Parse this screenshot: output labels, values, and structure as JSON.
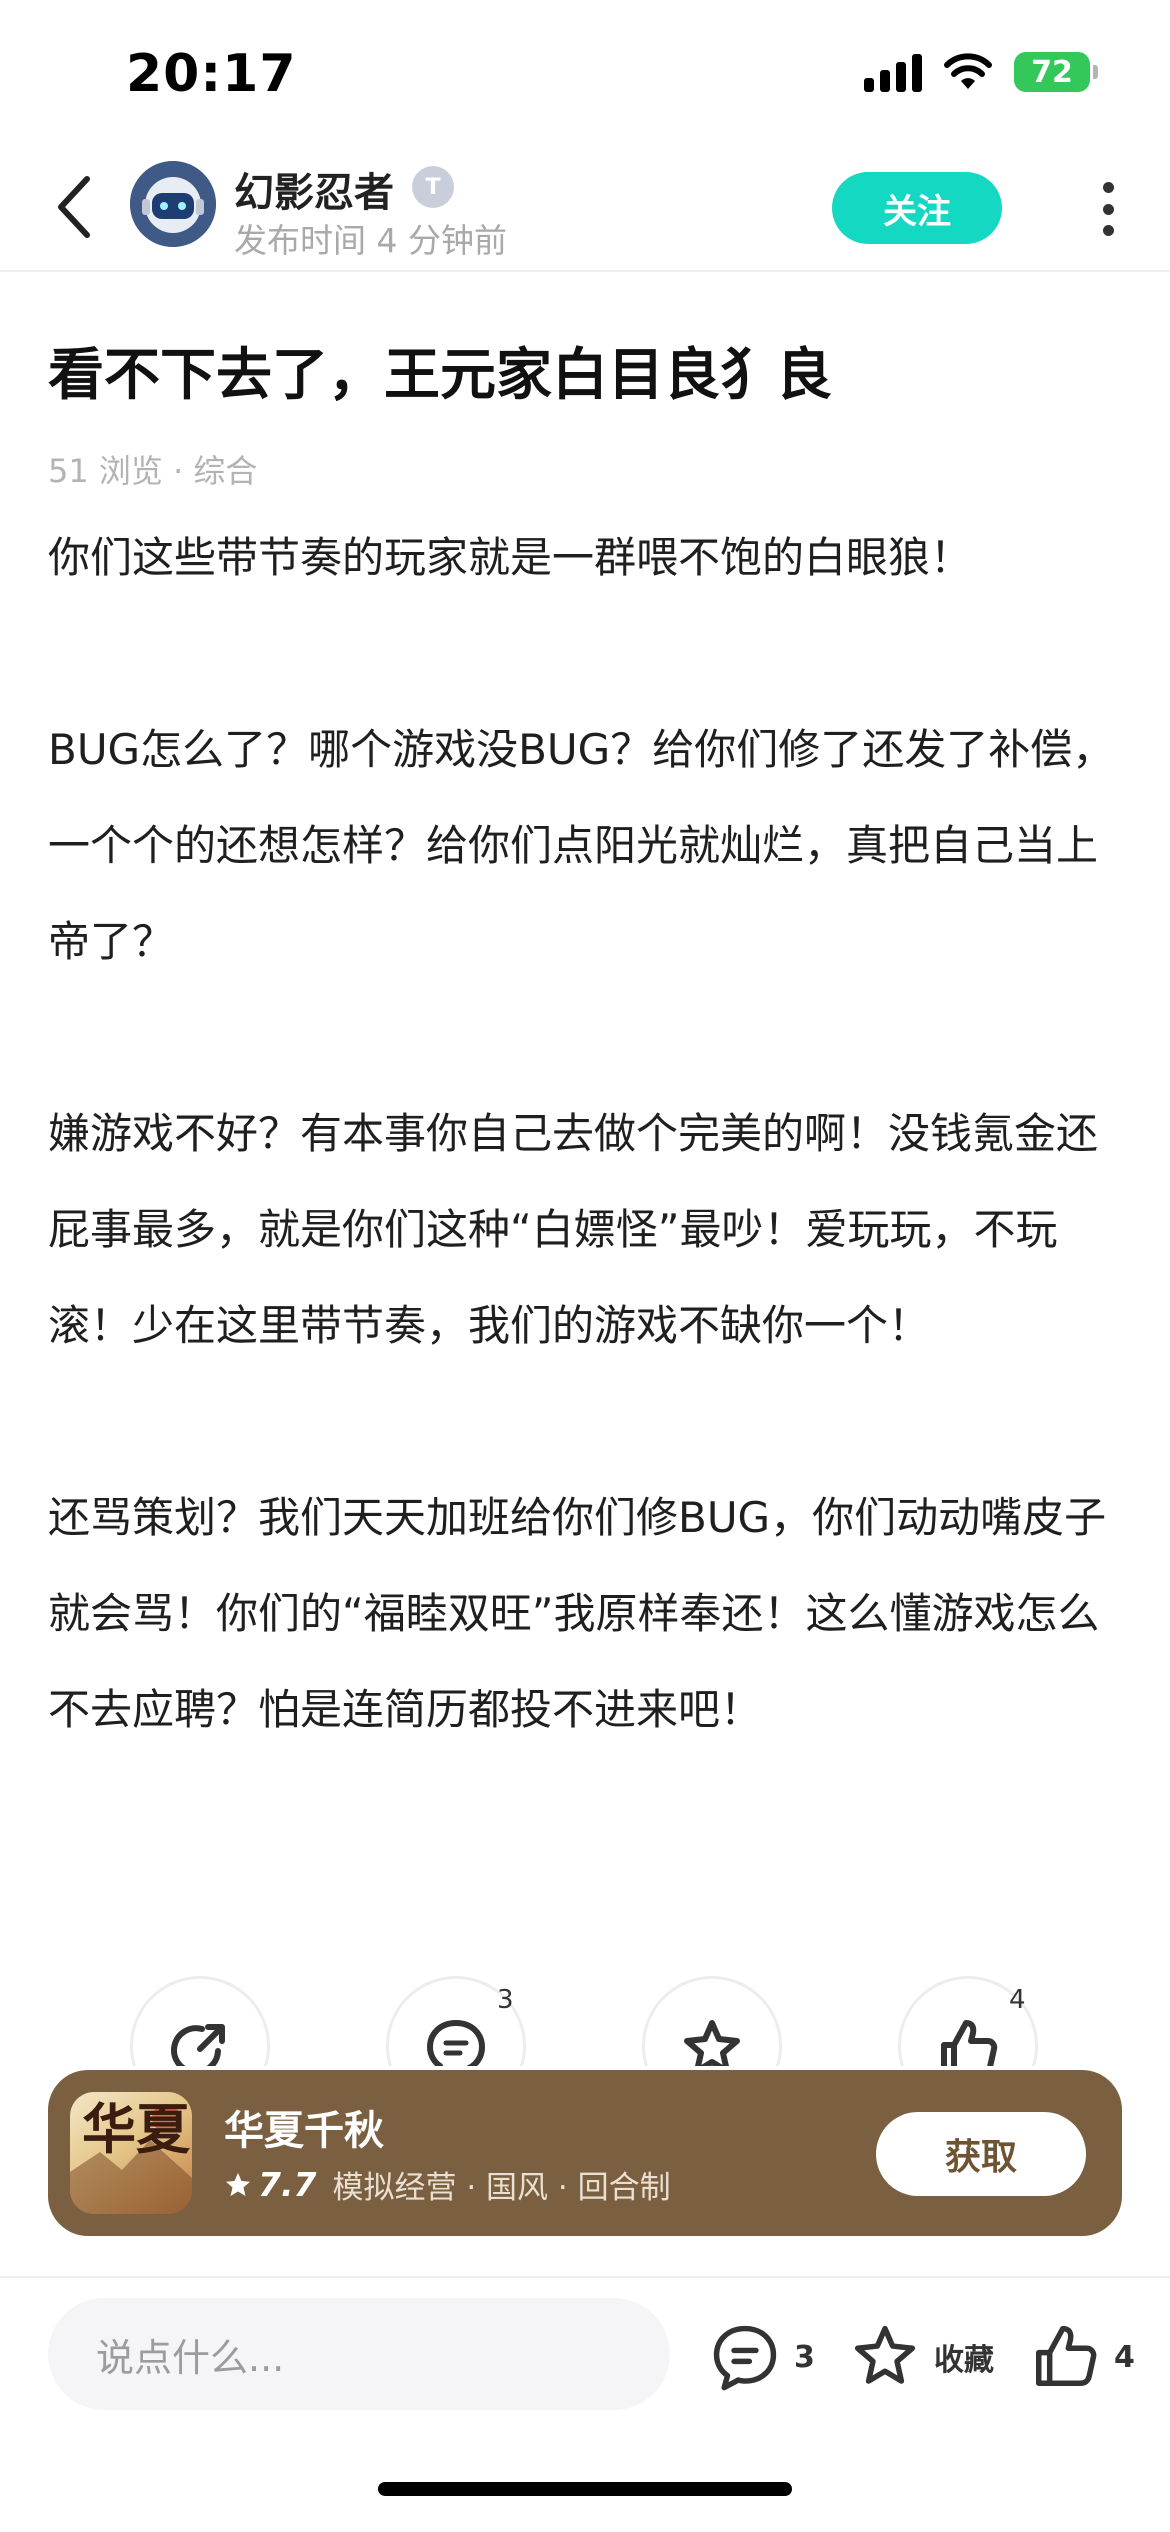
{
  "status_bar": {
    "time": "20:17",
    "battery": "72"
  },
  "header": {
    "author_name": "幻影忍者",
    "author_badge": "T",
    "post_time": "发布时间 4 分钟前",
    "follow_label": "关注"
  },
  "post": {
    "title": "看不下去了，王元家白目良犭良",
    "meta": "51 浏览 · 综合",
    "paragraphs": [
      "你们这些带节奏的玩家就是一群喂不饱的白眼狼！",
      "BUG怎么了？哪个游戏没BUG？给你们修了还发了补偿，一个个的还想怎样？给你们点阳光就灿烂，真把自己当上帝了？",
      "嫌游戏不好？有本事你自己去做个完美的啊！没钱氪金还屁事最多，就是你们这种“白嫖怪”最吵！爱玩玩，不玩滚！少在这里带节奏，我们的游戏不缺你一个！",
      "还骂策划？我们天天加班给你们修BUG，你们动动嘴皮子就会骂！你们的“福睦双旺”我原样奉还！这么懂游戏怎么不去应聘？怕是连简历都投不进来吧！"
    ]
  },
  "actions": {
    "comment_count": "3",
    "like_count": "4"
  },
  "game_card": {
    "icon_text": "华夏",
    "name": "华夏千秋",
    "rating": "7.7",
    "tags": "模拟经营 · 国风 · 回合制",
    "get_label": "获取"
  },
  "bottom_bar": {
    "input_placeholder": "说点什么...",
    "comment_count": "3",
    "collect_label": "收藏",
    "like_count": "4"
  },
  "colors": {
    "accent": "#14d8c2",
    "card_bg": "#7a6040",
    "battery": "#34c759"
  }
}
